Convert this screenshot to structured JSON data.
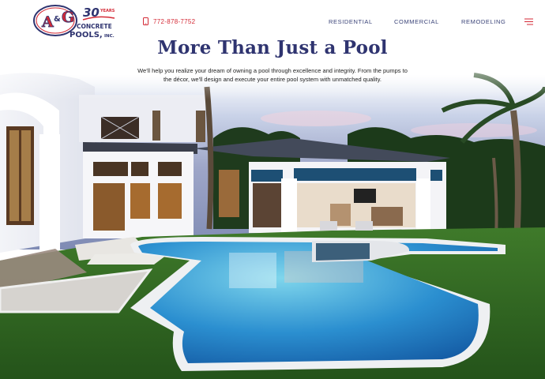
{
  "brand": {
    "logo_initials": "A&G",
    "logo_years": "30",
    "logo_years_word": "YEARS",
    "logo_line1": "CONCRETE",
    "logo_line2": "POOLS,",
    "logo_suffix": "INC.",
    "colors": {
      "navy": "#2f3470",
      "red": "#d42a36"
    }
  },
  "header": {
    "phone": "772-878-7752",
    "phone_icon": "mobile-phone-icon",
    "nav": [
      "RESIDENTIAL",
      "COMMERCIAL",
      "REMODELING"
    ],
    "menu_icon": "hamburger-menu-icon"
  },
  "hero": {
    "title": "More Than Just a Pool",
    "description": "We'll help you realize your dream of owning a pool through excellence and integrity. From the pumps to the décor, we'll design and execute your entire pool system with unmatched quality."
  }
}
